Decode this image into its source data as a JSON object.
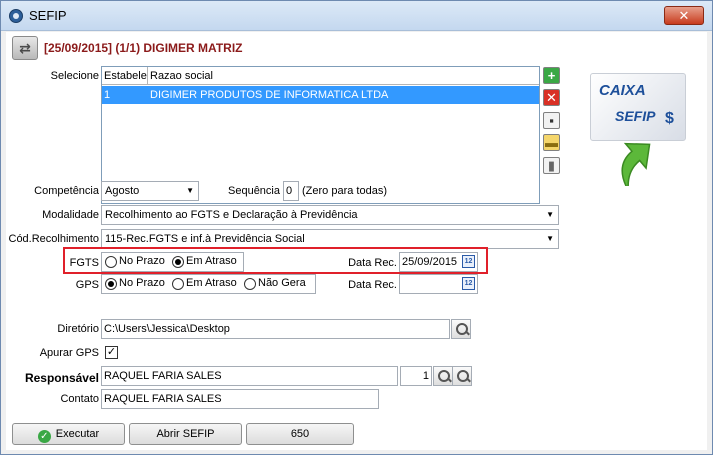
{
  "window": {
    "title": "SEFIP",
    "close_label": "✕"
  },
  "header": {
    "title": "[25/09/2015] (1/1) DIGIMER MATRIZ"
  },
  "selecione": {
    "label": "Selecione",
    "columns": [
      "Estabelecimento",
      "Razao social"
    ],
    "rows": [
      {
        "estab": "1",
        "razao": "DIGIMER PRODUTOS DE INFORMATICA LTDA"
      }
    ]
  },
  "logo": {
    "caixa": "CAIXA",
    "sefip": "SEFIP",
    "dollar": "$"
  },
  "competencia": {
    "label": "Competência",
    "value": "Agosto"
  },
  "sequencia": {
    "label": "Sequência",
    "value": "0",
    "hint": "(Zero para todas)"
  },
  "modalidade": {
    "label": "Modalidade",
    "value": "Recolhimento ao FGTS e Declaração à Previdência"
  },
  "cod_recolhimento": {
    "label": "Cód.Recolhimento",
    "value": "115-Rec.FGTS e inf.à Previdência Social"
  },
  "fgts": {
    "label": "FGTS",
    "options": [
      "No Prazo",
      "Em Atraso"
    ],
    "selected": "Em Atraso",
    "data_rec_label": "Data Rec.",
    "data_rec_value": "25/09/2015"
  },
  "gps": {
    "label": "GPS",
    "options": [
      "No Prazo",
      "Em Atraso",
      "Não Gera"
    ],
    "selected": "No Prazo",
    "data_rec_label": "Data Rec.",
    "data_rec_value": ""
  },
  "diretorio": {
    "label": "Diretório",
    "value": "C:\\Users\\Jessica\\Desktop"
  },
  "apurar_gps": {
    "label": "Apurar GPS",
    "checked": true,
    "check_glyph": "✓"
  },
  "responsavel": {
    "label": "Responsável",
    "value": "RAQUEL FARIA SALES",
    "code": "1"
  },
  "contato": {
    "label": "Contato",
    "value": "RAQUEL FARIA SALES"
  },
  "buttons": {
    "executar": "Executar",
    "abrir_sefip": "Abrir SEFIP",
    "count": "650"
  },
  "icons": {
    "add": "+",
    "remove": "✕",
    "save": "▪",
    "folder": "▬",
    "trash": "▮",
    "calendar": "12",
    "swap": "⇄"
  },
  "colors": {
    "header_title": "#8b1a1a",
    "selection": "#3399ff",
    "highlight_border": "#e0202a",
    "brand_blue": "#1d4f9a"
  }
}
